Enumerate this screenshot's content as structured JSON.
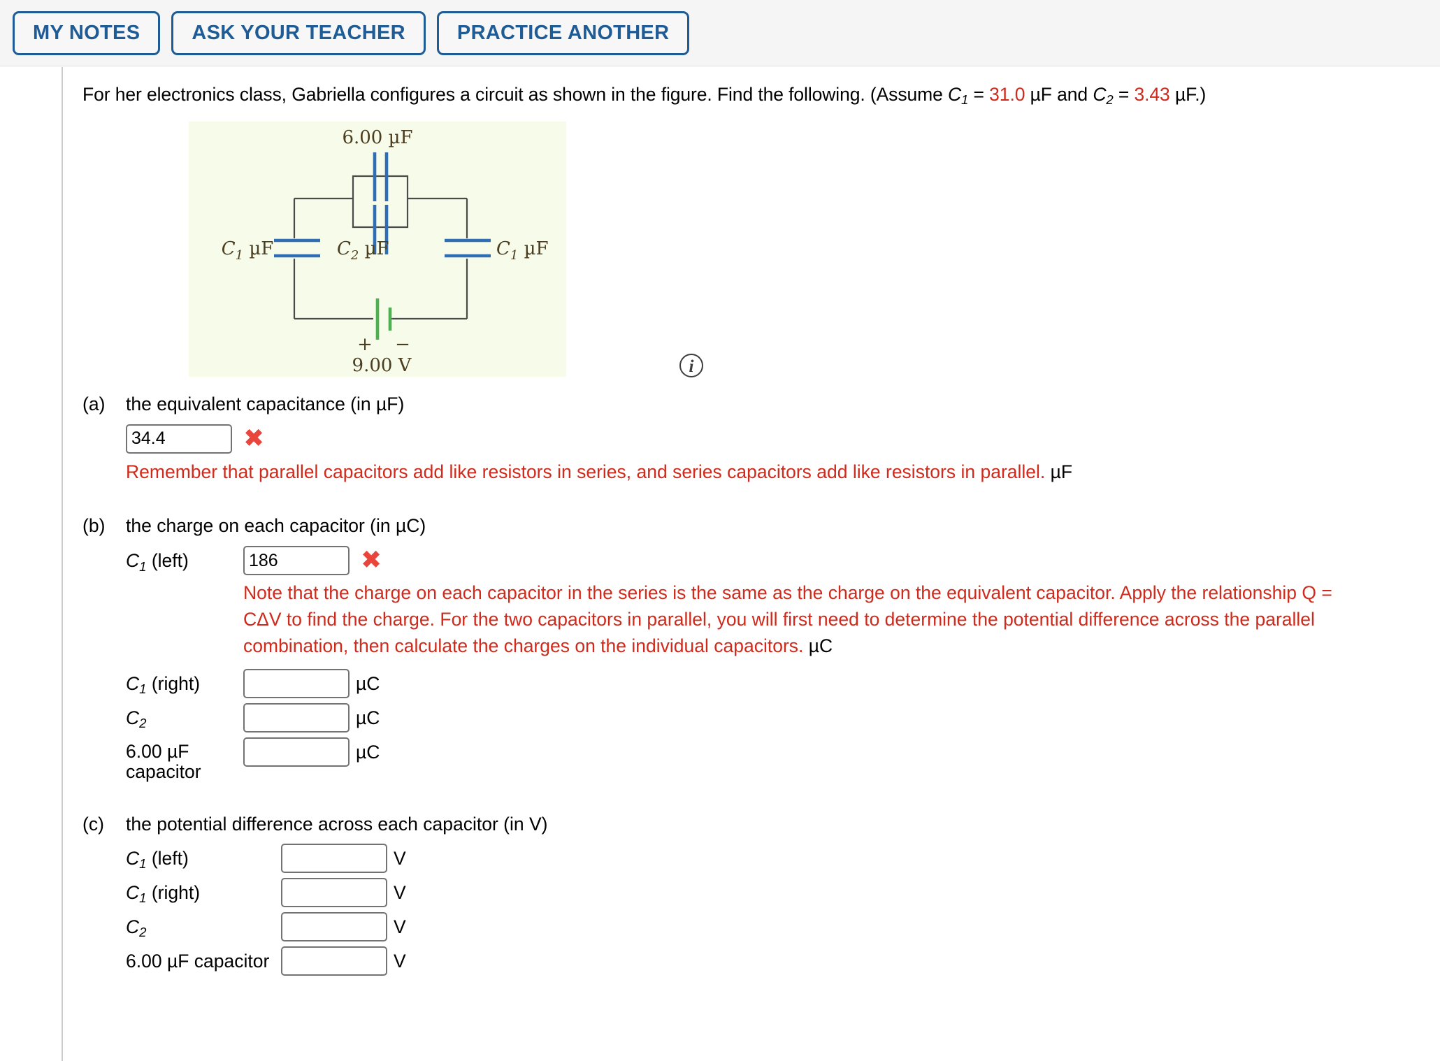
{
  "toolbar": {
    "buttons": [
      {
        "name": "my-notes",
        "label": "MY NOTES"
      },
      {
        "name": "ask-your-teacher",
        "label": "ASK YOUR TEACHER"
      },
      {
        "name": "practice-another",
        "label": "PRACTICE ANOTHER"
      }
    ]
  },
  "problem": {
    "intro_before": "For her electronics class, Gabriella configures a circuit as shown in the figure. Find the following. (Assume ",
    "c1_symbol": "C",
    "c1_sub": "1",
    "eq1": " = ",
    "c1_value": "31.0",
    "unit_uf_1": " µF and ",
    "c2_symbol": "C",
    "c2_sub": "2",
    "eq2": " = ",
    "c2_value": "3.43",
    "unit_uf_2": " µF.)"
  },
  "figure": {
    "name": "capacitor-circuit-diagram",
    "background_color": "#f7fbe9",
    "wire_color": "#4a4a4a",
    "capacitor_color": "#2f6eb5",
    "battery_color": "#4caf50",
    "label_color": "#4a3d20",
    "labels": {
      "top_capacitor": "6.00 µF",
      "left_capacitor": "C₁ µF",
      "middle_capacitor": "C₂ µF",
      "right_capacitor": "C₁ µF",
      "battery_voltage": "9.00 V",
      "battery_plus": "+",
      "battery_minus": "−"
    },
    "info_icon": "i"
  },
  "parts": {
    "a": {
      "letter": "(a)",
      "text": "the equivalent capacitance (in µF)",
      "input_value": "34.4",
      "input_placeholder": "",
      "mark": "✖",
      "feedback": "Remember that parallel capacitors add like resistors in series, and series capacitors add like resistors in parallel.",
      "feedback_unit": "µF"
    },
    "b": {
      "letter": "(b)",
      "text": "the charge on each capacitor (in µC)",
      "feedback": "Note that the charge on each capacitor in the series is the same as the charge on the equivalent capacitor. Apply the relationship Q = CΔV to find the charge. For the two capacitors in parallel, you will first need to determine the potential difference across the parallel combination, then calculate the charges on the individual capacitors.",
      "feedback_unit": "µC",
      "rows": [
        {
          "name": "c1-left",
          "label_main": "C",
          "label_sub": "1",
          "label_rest": " (left)",
          "value": "186",
          "placeholder": "",
          "unit": "",
          "mark": "✖"
        },
        {
          "name": "c1-right",
          "label_main": "C",
          "label_sub": "1",
          "label_rest": " (right)",
          "value": "",
          "placeholder": "",
          "unit": "µC",
          "mark": ""
        },
        {
          "name": "c2",
          "label_main": "C",
          "label_sub": "2",
          "label_rest": "",
          "value": "",
          "placeholder": "",
          "unit": "µC",
          "mark": ""
        },
        {
          "name": "six-uf-capacitor",
          "label_main": "",
          "label_sub": "",
          "label_rest": "6.00 µF capacitor",
          "value": "",
          "placeholder": "",
          "unit": "µC",
          "mark": ""
        }
      ]
    },
    "c": {
      "letter": "(c)",
      "text": "the potential difference across each capacitor (in V)",
      "rows": [
        {
          "name": "c1-left",
          "label_main": "C",
          "label_sub": "1",
          "label_rest": " (left)",
          "value": "",
          "placeholder": "",
          "unit": "V"
        },
        {
          "name": "c1-right",
          "label_main": "C",
          "label_sub": "1",
          "label_rest": " (right)",
          "value": "",
          "placeholder": "",
          "unit": "V"
        },
        {
          "name": "c2",
          "label_main": "C",
          "label_sub": "2",
          "label_rest": "",
          "value": "",
          "placeholder": "",
          "unit": "V"
        },
        {
          "name": "six-uf-capacitor",
          "label_main": "",
          "label_sub": "",
          "label_rest": "6.00 µF capacitor",
          "value": "",
          "placeholder": "",
          "unit": "V"
        }
      ]
    }
  },
  "colors": {
    "accent_blue": "#1f5b94",
    "error_red": "#cf2a1b",
    "x_red": "#e8453c",
    "value_red": "#cf2a1b"
  }
}
